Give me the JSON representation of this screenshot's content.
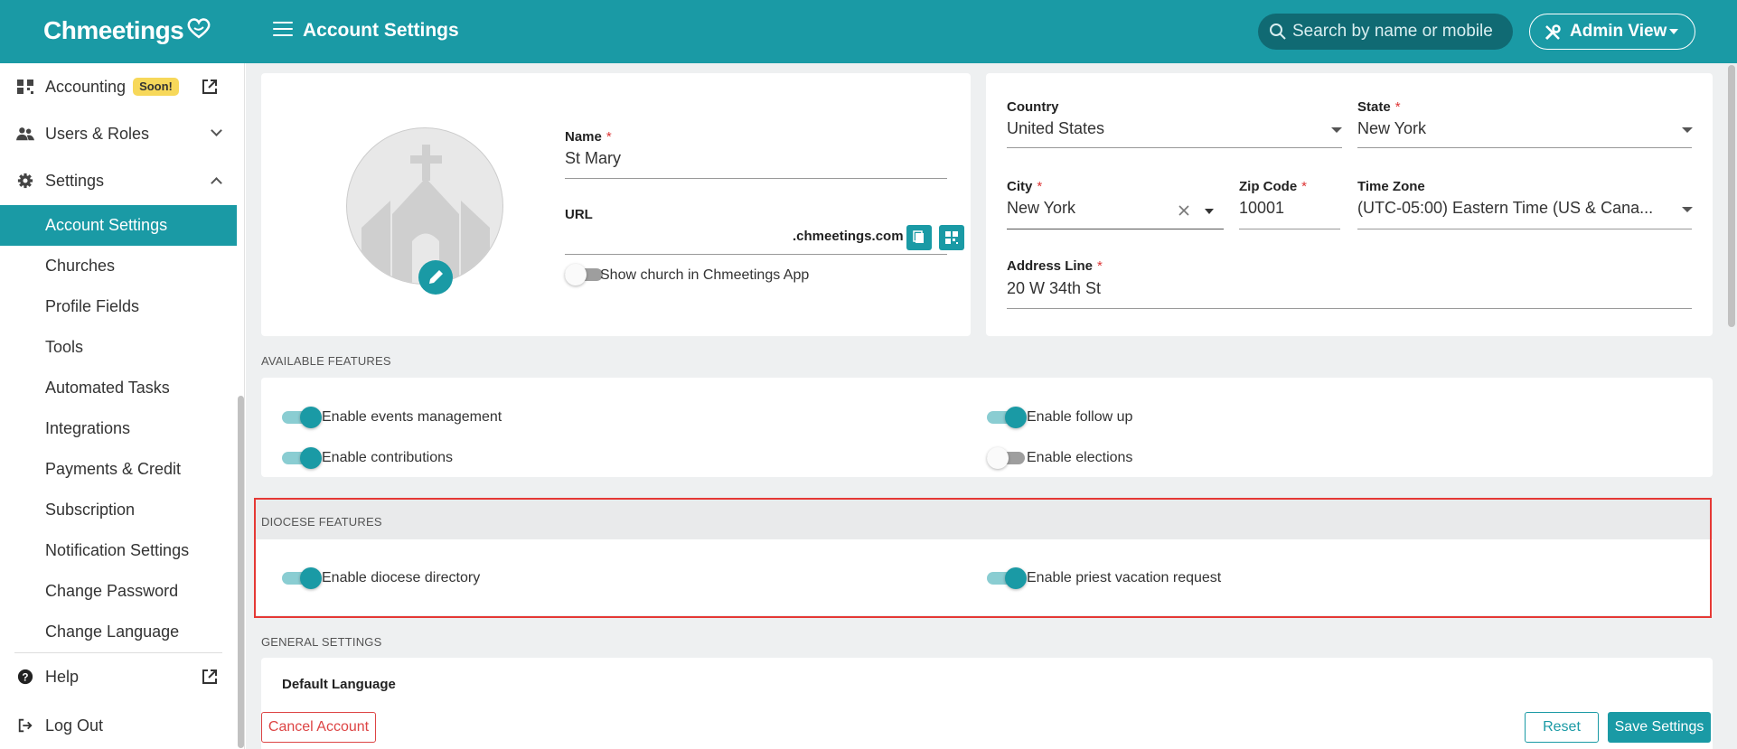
{
  "app": {
    "logo_text": "Chmeetings",
    "page_title": "Account Settings",
    "search_placeholder": "Search by name or mobile",
    "admin_view_label": "Admin View"
  },
  "sidebar": {
    "accounting_label": "Accounting",
    "accounting_badge": "Soon!",
    "users_roles_label": "Users & Roles",
    "settings_label": "Settings",
    "settings_items": [
      "Account Settings",
      "Churches",
      "Profile Fields",
      "Tools",
      "Automated Tasks",
      "Integrations",
      "Payments & Credit",
      "Subscription",
      "Notification Settings",
      "Change Password",
      "Change Language"
    ],
    "help_label": "Help",
    "logout_label": "Log Out"
  },
  "church": {
    "name_label": "Name",
    "name_value": "St Mary",
    "url_label": "URL",
    "url_suffix": ".chmeetings.com",
    "show_in_app_label": "Show church in Chmeetings App"
  },
  "address": {
    "country_label": "Country",
    "country_value": "United States",
    "state_label": "State",
    "state_value": "New York",
    "city_label": "City",
    "city_value": "New York",
    "zip_label": "Zip Code",
    "zip_value": "10001",
    "timezone_label": "Time Zone",
    "timezone_value": "(UTC-05:00) Eastern Time (US & Cana...",
    "address_line_label": "Address Line",
    "address_line_value": "20 W 34th St"
  },
  "available_features": {
    "title": "AVAILABLE FEATURES",
    "events_label": "Enable events management",
    "followup_label": "Enable follow up",
    "contributions_label": "Enable contributions",
    "elections_label": "Enable elections"
  },
  "diocese_features": {
    "title": "DIOCESE FEATURES",
    "directory_label": "Enable diocese directory",
    "vacation_label": "Enable priest vacation request"
  },
  "general_settings": {
    "title": "GENERAL SETTINGS",
    "default_language_label": "Default Language"
  },
  "actions": {
    "cancel_account": "Cancel Account",
    "reset": "Reset",
    "save": "Save Settings"
  },
  "colors": {
    "accent": "#1a9aa5",
    "danger": "#e53935",
    "badge": "#f7d85a"
  }
}
